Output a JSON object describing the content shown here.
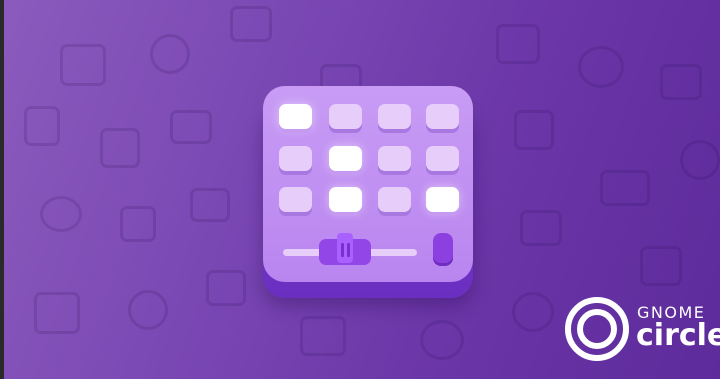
{
  "badge": {
    "line1": "GNOME",
    "line2": "circle"
  },
  "icons": {
    "app": "drum-machine-pad-icon",
    "badge_logo": "gnome-circle-logo-icon"
  },
  "colors": {
    "background_start": "#8b5bbd",
    "background_end": "#5d2b9b",
    "icon_face": "#c89cf5",
    "icon_base": "#7c3fd0",
    "pad": "#e6cdfa",
    "pad_lit": "#ffffff",
    "fader": "#9246e8",
    "badge_text": "#ffffff"
  }
}
